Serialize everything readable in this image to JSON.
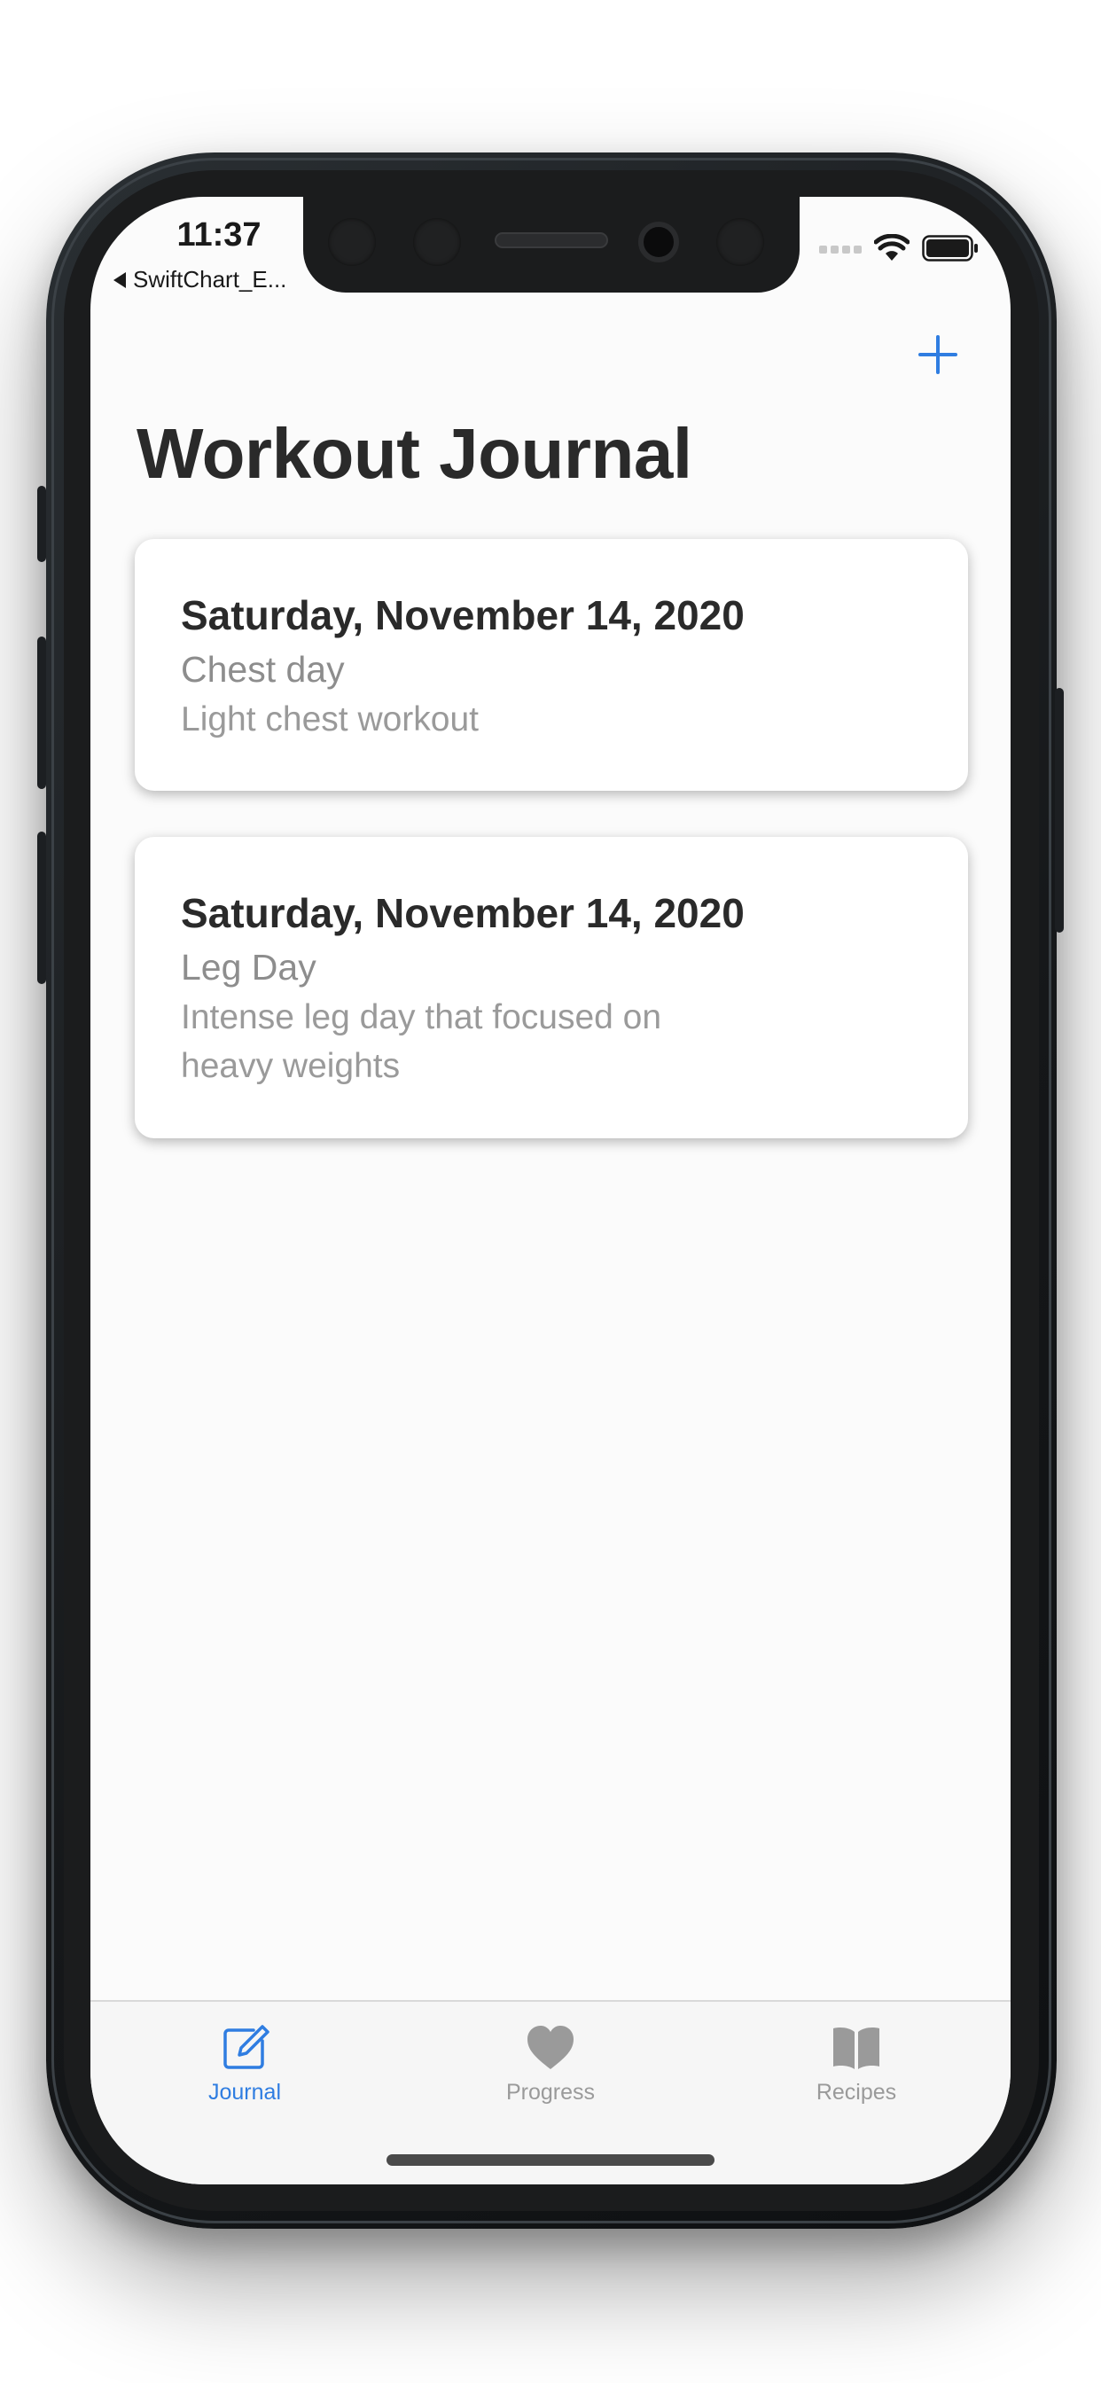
{
  "status_bar": {
    "time": "11:37",
    "back_app": "SwiftChart_E...",
    "icons": [
      "signal-icon",
      "wifi-icon",
      "battery-icon"
    ]
  },
  "nav": {
    "title": "Workout Journal",
    "add_icon": "plus-icon"
  },
  "entries": [
    {
      "date": "Saturday, November 14, 2020",
      "title": "Chest day",
      "description": "Light chest workout"
    },
    {
      "date": "Saturday, November 14, 2020",
      "title": "Leg Day",
      "description": "Intense leg day that focused on heavy weights"
    }
  ],
  "tab_bar": {
    "tabs": [
      {
        "label": "Journal",
        "icon": "compose-icon",
        "selected": true
      },
      {
        "label": "Progress",
        "icon": "heart-icon",
        "selected": false
      },
      {
        "label": "Recipes",
        "icon": "book-icon",
        "selected": false
      }
    ]
  },
  "colors": {
    "accent": "#2f7de1",
    "inactive": "#9a9a9a",
    "title_text": "#2a2a2a",
    "background": "#fbfbfb"
  }
}
